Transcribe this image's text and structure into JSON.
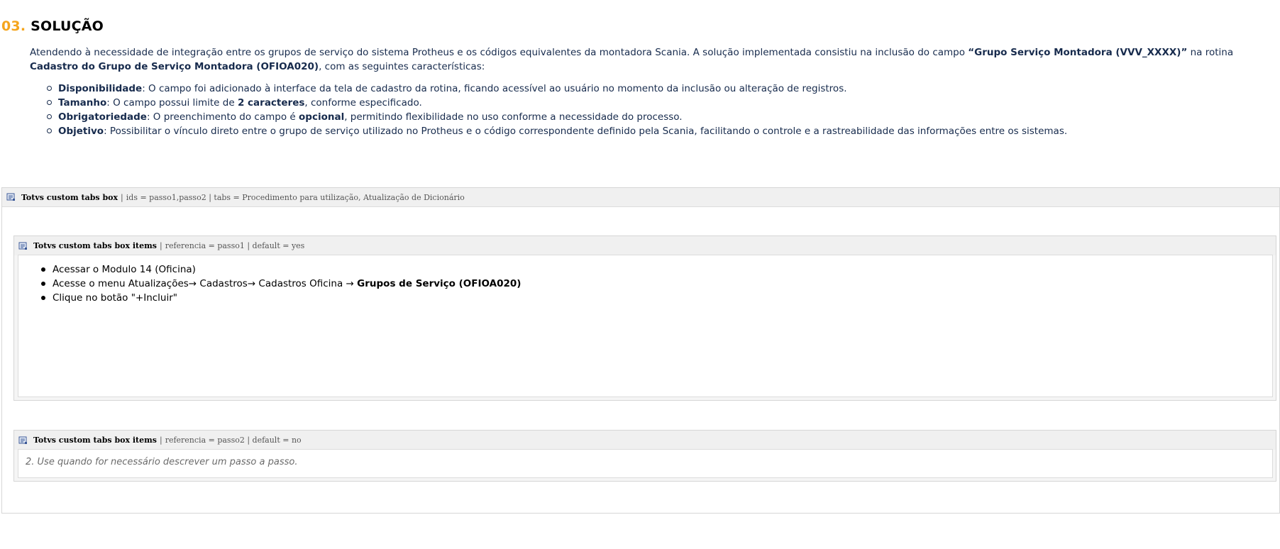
{
  "section": {
    "number": "03.",
    "title": "SOLUÇÃO"
  },
  "intro": {
    "part1": "Atendendo à necessidade de integração entre os grupos de serviço do sistema Protheus e os códigos equivalentes da montadora Scania. A solução implementada consistiu na inclusão do campo ",
    "field_name": "“Grupo Serviço Montadora (VVV_XXXX)”",
    "part2": " na rotina ",
    "routine_name": "Cadastro do Grupo de Serviço Montadora (OFIOA020)",
    "part3": ", com as seguintes características:"
  },
  "features": [
    {
      "label": "Disponibilidade",
      "text_a": ": O campo foi adicionado à interface da tela de cadastro da rotina, ficando acessível ao usuário no momento da inclusão ou alteração de registros.",
      "bold": "",
      "text_b": ""
    },
    {
      "label": "Tamanho",
      "text_a": ": O campo possui limite de ",
      "bold": "2 caracteres",
      "text_b": ", conforme especificado."
    },
    {
      "label": "Obrigatoriedade",
      "text_a": ": O preenchimento do campo é ",
      "bold": "opcional",
      "text_b": ", permitindo flexibilidade no uso conforme a necessidade do processo."
    },
    {
      "label": "Objetivo",
      "text_a": ": Possibilitar o vínculo direto entre o grupo de serviço utilizado no Protheus e o código correspondente definido pela Scania, facilitando o controle e a rastreabilidade das informações entre os sistemas.",
      "bold": "",
      "text_b": ""
    }
  ],
  "tabs_box": {
    "name": "Totvs custom tabs box",
    "params": "ids = passo1,passo2 | tabs = Procedimento para utilização, Atualização de Dicionário"
  },
  "tab_item_1": {
    "name": "Totvs custom tabs box items",
    "params": "referencia = passo1 | default = yes",
    "steps": [
      {
        "text": "Acessar o Modulo 14 (Oficina)",
        "bold": ""
      },
      {
        "text": "Acesse o menu Atualizações→ Cadastros→ Cadastros Oficina → ",
        "bold": "Grupos de Serviço (OFIOA020)"
      },
      {
        "text": "Clique no botão \"+Incluir\"",
        "bold": ""
      }
    ]
  },
  "tab_item_2": {
    "name": "Totvs custom tabs box items",
    "params": "referencia = passo2 | default = no",
    "hint": "2. Use quando for necessário descrever um passo a passo."
  }
}
